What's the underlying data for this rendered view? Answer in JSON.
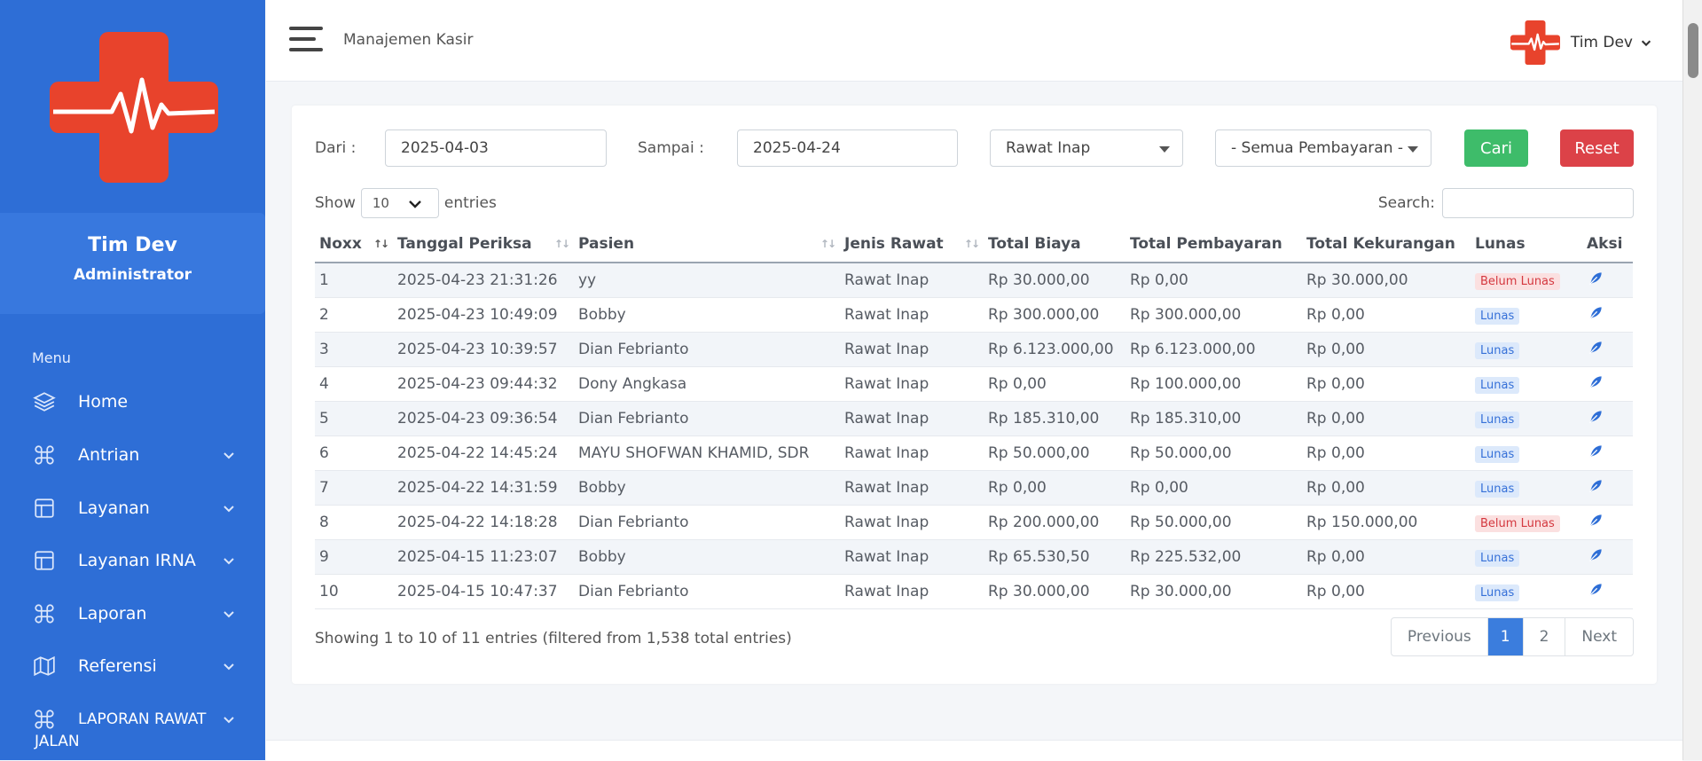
{
  "app": {
    "page_title": "Manajemen Kasir",
    "user": {
      "name": "Tim Dev",
      "role": "Administrator"
    },
    "colors": {
      "sidebar": "#2e6ed6",
      "logo_red": "#e8432c",
      "success": "#3ebc6a",
      "danger": "#dc4248",
      "primary": "#3b7ddd"
    }
  },
  "sidebar": {
    "menu_heading": "Menu",
    "items": [
      {
        "label": "Home",
        "icon": "layers-icon"
      },
      {
        "label": "Antrian",
        "icon": "command-icon"
      },
      {
        "label": "Layanan",
        "icon": "layout-icon"
      },
      {
        "label": "Layanan IRNA",
        "icon": "layout-icon"
      },
      {
        "label": "Laporan",
        "icon": "command-icon"
      },
      {
        "label": "Referensi",
        "icon": "map-icon"
      },
      {
        "label": "LAPORAN RAWAT",
        "label2": "JALAN",
        "icon": "command-icon"
      }
    ]
  },
  "filters": {
    "dari_label": "Dari :",
    "dari_value": "2025-04-03",
    "sampai_label": "Sampai :",
    "sampai_value": "2025-04-24",
    "jenis_rawat": "Rawat Inap",
    "pembayaran": "- Semua Pembayaran -",
    "cari": "Cari",
    "reset": "Reset"
  },
  "table_controls": {
    "show": "Show",
    "length": "10",
    "entries": "entries",
    "search_label": "Search:"
  },
  "table": {
    "headers": [
      "Noxx",
      "Tanggal Periksa",
      "Pasien",
      "Jenis Rawat",
      "Total Biaya",
      "Total Pembayaran",
      "Total Kekurangan",
      "Lunas",
      "Aksi"
    ],
    "rows": [
      {
        "no": "1",
        "tanggal": "2025-04-23 21:31:26",
        "pasien": "yy",
        "jenis": "Rawat Inap",
        "biaya": "Rp 30.000,00",
        "bayar": "Rp 0,00",
        "kurang": "Rp 30.000,00",
        "status": "Belum Lunas"
      },
      {
        "no": "2",
        "tanggal": "2025-04-23 10:49:09",
        "pasien": "Bobby",
        "jenis": "Rawat Inap",
        "biaya": "Rp 300.000,00",
        "bayar": "Rp 300.000,00",
        "kurang": "Rp 0,00",
        "status": "Lunas"
      },
      {
        "no": "3",
        "tanggal": "2025-04-23 10:39:57",
        "pasien": "Dian Febrianto",
        "jenis": "Rawat Inap",
        "biaya": "Rp 6.123.000,00",
        "bayar": "Rp 6.123.000,00",
        "kurang": "Rp 0,00",
        "status": "Lunas"
      },
      {
        "no": "4",
        "tanggal": "2025-04-23 09:44:32",
        "pasien": "Dony Angkasa",
        "jenis": "Rawat Inap",
        "biaya": "Rp 0,00",
        "bayar": "Rp 100.000,00",
        "kurang": "Rp 0,00",
        "status": "Lunas"
      },
      {
        "no": "5",
        "tanggal": "2025-04-23 09:36:54",
        "pasien": "Dian Febrianto",
        "jenis": "Rawat Inap",
        "biaya": "Rp 185.310,00",
        "bayar": "Rp 185.310,00",
        "kurang": "Rp 0,00",
        "status": "Lunas"
      },
      {
        "no": "6",
        "tanggal": "2025-04-22 14:45:24",
        "pasien": "MAYU SHOFWAN KHAMID, SDR",
        "jenis": "Rawat Inap",
        "biaya": "Rp 50.000,00",
        "bayar": "Rp 50.000,00",
        "kurang": "Rp 0,00",
        "status": "Lunas"
      },
      {
        "no": "7",
        "tanggal": "2025-04-22 14:31:59",
        "pasien": "Bobby",
        "jenis": "Rawat Inap",
        "biaya": "Rp 0,00",
        "bayar": "Rp 0,00",
        "kurang": "Rp 0,00",
        "status": "Lunas"
      },
      {
        "no": "8",
        "tanggal": "2025-04-22 14:18:28",
        "pasien": "Dian Febrianto",
        "jenis": "Rawat Inap",
        "biaya": "Rp 200.000,00",
        "bayar": "Rp 50.000,00",
        "kurang": "Rp 150.000,00",
        "status": "Belum Lunas"
      },
      {
        "no": "9",
        "tanggal": "2025-04-15 11:23:07",
        "pasien": "Bobby",
        "jenis": "Rawat Inap",
        "biaya": "Rp 65.530,50",
        "bayar": "Rp 225.532,00",
        "kurang": "Rp 0,00",
        "status": "Lunas"
      },
      {
        "no": "10",
        "tanggal": "2025-04-15 10:47:37",
        "pasien": "Dian Febrianto",
        "jenis": "Rawat Inap",
        "biaya": "Rp 30.000,00",
        "bayar": "Rp 30.000,00",
        "kurang": "Rp 0,00",
        "status": "Lunas"
      }
    ]
  },
  "footer": {
    "info": "Showing 1 to 10 of 11 entries (filtered from 1,538 total entries)",
    "pagination": {
      "previous": "Previous",
      "pages": [
        "1",
        "2"
      ],
      "active_page": "1",
      "next": "Next"
    }
  }
}
